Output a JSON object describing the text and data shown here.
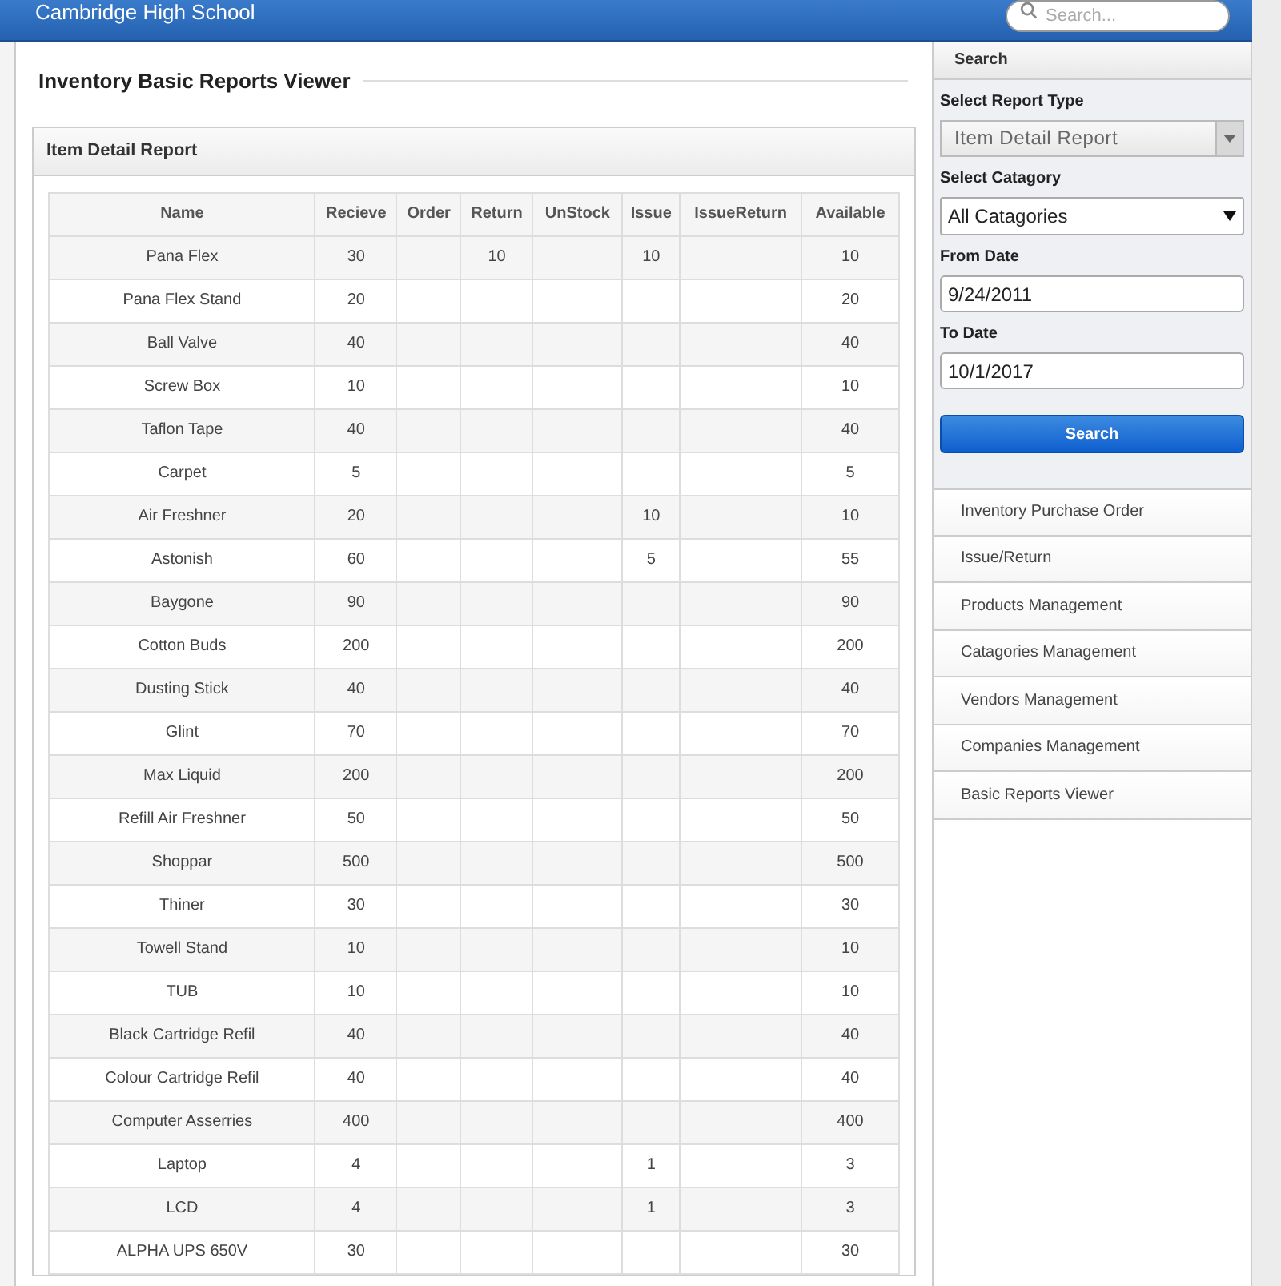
{
  "header": {
    "title": "Cambridge High School",
    "search": {
      "placeholder": "Search..."
    }
  },
  "page_title": "Inventory Basic Reports Viewer",
  "report": {
    "title": "Item Detail Report",
    "table": {
      "columns": [
        "Name",
        "Recieve",
        "Order",
        "Return",
        "UnStock",
        "Issue",
        "IssueReturn",
        "Available"
      ],
      "rows": [
        [
          "Pana Flex",
          "30",
          "",
          "10",
          "",
          "10",
          "",
          "10"
        ],
        [
          "Pana Flex Stand",
          "20",
          "",
          "",
          "",
          "",
          "",
          "20"
        ],
        [
          "Ball Valve",
          "40",
          "",
          "",
          "",
          "",
          "",
          "40"
        ],
        [
          "Screw Box",
          "10",
          "",
          "",
          "",
          "",
          "",
          "10"
        ],
        [
          "Taflon Tape",
          "40",
          "",
          "",
          "",
          "",
          "",
          "40"
        ],
        [
          "Carpet",
          "5",
          "",
          "",
          "",
          "",
          "",
          "5"
        ],
        [
          "Air Freshner",
          "20",
          "",
          "",
          "",
          "10",
          "",
          "10"
        ],
        [
          "Astonish",
          "60",
          "",
          "",
          "",
          "5",
          "",
          "55"
        ],
        [
          "Baygone",
          "90",
          "",
          "",
          "",
          "",
          "",
          "90"
        ],
        [
          "Cotton Buds",
          "200",
          "",
          "",
          "",
          "",
          "",
          "200"
        ],
        [
          "Dusting Stick",
          "40",
          "",
          "",
          "",
          "",
          "",
          "40"
        ],
        [
          "Glint",
          "70",
          "",
          "",
          "",
          "",
          "",
          "70"
        ],
        [
          "Max Liquid",
          "200",
          "",
          "",
          "",
          "",
          "",
          "200"
        ],
        [
          "Refill Air Freshner",
          "50",
          "",
          "",
          "",
          "",
          "",
          "50"
        ],
        [
          "Shoppar",
          "500",
          "",
          "",
          "",
          "",
          "",
          "500"
        ],
        [
          "Thiner",
          "30",
          "",
          "",
          "",
          "",
          "",
          "30"
        ],
        [
          "Towell Stand",
          "10",
          "",
          "",
          "",
          "",
          "",
          "10"
        ],
        [
          "TUB",
          "10",
          "",
          "",
          "",
          "",
          "",
          "10"
        ],
        [
          "Black Cartridge Refil",
          "40",
          "",
          "",
          "",
          "",
          "",
          "40"
        ],
        [
          "Colour Cartridge Refil",
          "40",
          "",
          "",
          "",
          "",
          "",
          "40"
        ],
        [
          "Computer Asserries",
          "400",
          "",
          "",
          "",
          "",
          "",
          "400"
        ],
        [
          "Laptop",
          "4",
          "",
          "",
          "",
          "1",
          "",
          "3"
        ],
        [
          "LCD",
          "4",
          "",
          "",
          "",
          "1",
          "",
          "3"
        ],
        [
          "ALPHA UPS 650V",
          "30",
          "",
          "",
          "",
          "",
          "",
          "30"
        ]
      ]
    }
  },
  "sidebar": {
    "title": "Search",
    "fields": [
      {
        "kind": "combo",
        "label": "Select Report Type",
        "value": "Item Detail Report"
      },
      {
        "kind": "select",
        "label": "Select Catagory",
        "value": "All Catagories"
      },
      {
        "kind": "text",
        "label": "From Date",
        "value": "9/24/2011"
      },
      {
        "kind": "text",
        "label": "To Date",
        "value": "10/1/2017"
      }
    ],
    "button": "Search",
    "menu": [
      "Inventory Purchase Order",
      "Issue/Return",
      "Products Management",
      "Catagories Management",
      "Vendors Management",
      "Companies Management",
      "Basic Reports Viewer"
    ]
  }
}
